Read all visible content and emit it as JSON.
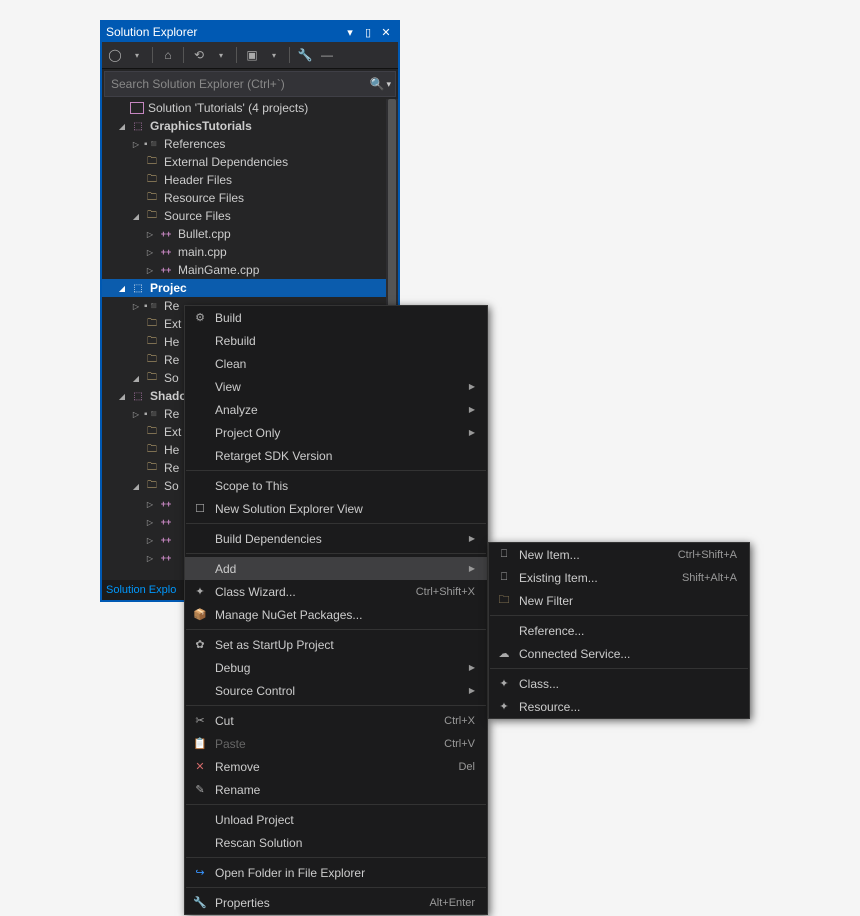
{
  "panel": {
    "title": "Solution Explorer",
    "search_placeholder": "Search Solution Explorer (Ctrl+`)",
    "solution_label": "Solution 'Tutorials' (4 projects)",
    "tab_label": "Solution Explo"
  },
  "proj1": {
    "name": "GraphicsTutorials",
    "refs": "References",
    "ext": "External Dependencies",
    "hdr": "Header Files",
    "res": "Resource Files",
    "src": "Source Files",
    "f1": "Bullet.cpp",
    "f2": "main.cpp",
    "f3": "MainGame.cpp"
  },
  "proj2": {
    "name": "Projec",
    "refs": "Re",
    "ext": "Ext",
    "hdr": "He",
    "res": "Re",
    "src": "So"
  },
  "proj3": {
    "name": "Shado",
    "refs": "Re",
    "ext": "Ext",
    "hdr": "He",
    "res": "Re",
    "src": "So"
  },
  "m": {
    "build": "Build",
    "rebuild": "Rebuild",
    "clean": "Clean",
    "view": "View",
    "analyze": "Analyze",
    "project_only": "Project Only",
    "retarget": "Retarget SDK Version",
    "scope": "Scope to This",
    "new_view": "New Solution Explorer View",
    "build_dep": "Build Dependencies",
    "add": "Add",
    "class_wizard": "Class Wizard...",
    "class_wizard_sc": "Ctrl+Shift+X",
    "nuget": "Manage NuGet Packages...",
    "startup": "Set as StartUp Project",
    "debug": "Debug",
    "source_ctrl": "Source Control",
    "cut": "Cut",
    "cut_sc": "Ctrl+X",
    "paste": "Paste",
    "paste_sc": "Ctrl+V",
    "remove": "Remove",
    "remove_sc": "Del",
    "rename": "Rename",
    "unload": "Unload Project",
    "rescan": "Rescan Solution",
    "open_folder": "Open Folder in File Explorer",
    "props": "Properties",
    "props_sc": "Alt+Enter"
  },
  "sm": {
    "new_item": "New Item...",
    "new_item_sc": "Ctrl+Shift+A",
    "existing": "Existing Item...",
    "existing_sc": "Shift+Alt+A",
    "new_filter": "New Filter",
    "reference": "Reference...",
    "connected": "Connected Service...",
    "class": "Class...",
    "resource": "Resource..."
  }
}
